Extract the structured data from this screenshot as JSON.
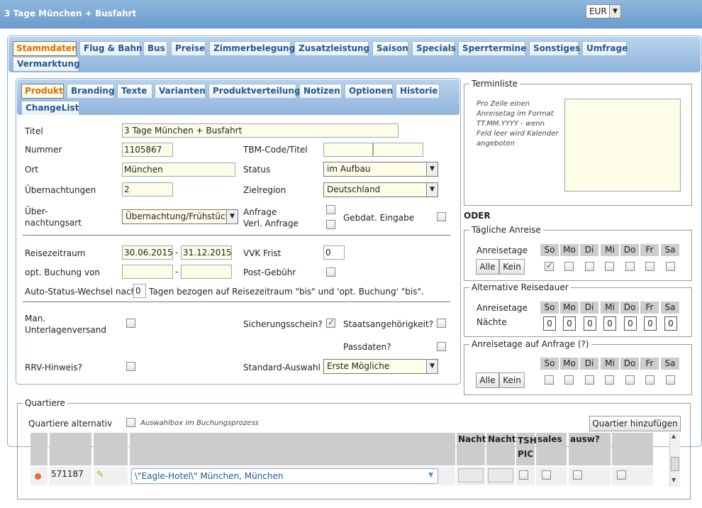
{
  "window_title": "3 Tage München + Busfahrt",
  "currency": {
    "value": "EUR"
  },
  "main_tabs": [
    "Stammdaten",
    "Flug & Bahn",
    "Bus",
    "Preise",
    "Zimmerbelegung",
    "Zusatzleistung",
    "Saison",
    "Specials",
    "Sperrtermine",
    "Sonstiges",
    "Umfrage",
    "Vermarktung"
  ],
  "sub_tabs": [
    "Produkt",
    "Branding",
    "Texte",
    "Varianten",
    "Produktverteilung",
    "Notizen",
    "Optionen",
    "Historie",
    "ChangeList"
  ],
  "form": {
    "titel_label": "Titel",
    "titel_value": "3 Tage München + Busfahrt",
    "nummer_label": "Nummer",
    "nummer_value": "1105867",
    "tbm_label": "TBM-Code/Titel",
    "ort_label": "Ort",
    "ort_value": "München",
    "status_label": "Status",
    "status_value": "im Aufbau",
    "uebernachtungen_label": "Übernachtungen",
    "uebernachtungen_value": "2",
    "zielregion_label": "Zielregion",
    "zielregion_value": "Deutschland",
    "art_label_1": "Über-",
    "art_label_2": "nachtungsart",
    "art_value": "Übernachtung/Frühstück",
    "anfrage_label": "Anfrage",
    "verl_anfrage_label": "Verl. Anfrage",
    "gebdat_label": "Gebdat. Eingabe",
    "reisezeitraum_label": "Reisezeitraum",
    "reise_from": "30.06.2015",
    "reise_sep": "-",
    "reise_to": "31.12.2015",
    "vvk_label": "VVK Frist",
    "vvk_value": "0",
    "opt_buchung_label": "opt. Buchung von",
    "opt_sep": "-",
    "post_label": "Post-Gebühr",
    "auto_status_pre": "Auto-Status-Wechsel nach",
    "auto_status_value": "0",
    "auto_status_post": "Tagen bezogen auf Reisezeitraum \"bis\" und 'opt. Buchung' \"bis\".",
    "man_label_1": "Man.",
    "man_label_2": "Unterlagenversand",
    "sicherung_label": "Sicherungsschein?",
    "staat_label": "Staatsangehörigkeit?",
    "pass_label": "Passdaten?",
    "rrv_label": "RRV-Hinweis?",
    "standard_label": "Standard-Auswahl",
    "standard_value": "Erste Mögliche"
  },
  "terminliste": {
    "legend": "Terminliste",
    "hint": "Pro Zeile einen Anreisetag im Format TT.MM.YYYY - wenn Feld leer wird Kalender angeboten"
  },
  "oder": "ODER",
  "taegliche": {
    "legend": "Tägliche Anreise",
    "label": "Anreisetage",
    "btn_alle": "Alle",
    "btn_kein": "Kein"
  },
  "alternative": {
    "legend": "Alternative Reisedauer",
    "label": "Anreisetage",
    "naechte_label": "Nächte",
    "values": [
      "0",
      "0",
      "0",
      "0",
      "0",
      "0",
      "0"
    ]
  },
  "anfrage_tage": {
    "legend": "Anreisetage auf Anfrage (?)",
    "btn_alle": "Alle",
    "btn_kein": "Kein"
  },
  "days": [
    "So",
    "Mo",
    "Di",
    "Mi",
    "Do",
    "Fr",
    "Sa"
  ],
  "quartiere": {
    "legend": "Quartiere",
    "alt_label": "Quartiere alternativ",
    "auswahl_note": "Auswahlbox im Buchungsprozess",
    "add_button": "Quartier hinzufügen",
    "headers": [
      "Nacht",
      "Nacht",
      "TSH PIC",
      "sales",
      "ausw?"
    ],
    "row": {
      "id": "571187",
      "hotel": "\\\"Eagle-Hotel\\\" München, München"
    }
  },
  "colors": {
    "accent": "#e06a0c",
    "tab_text": "#24588e",
    "titlebar": "#6a9ccf"
  }
}
